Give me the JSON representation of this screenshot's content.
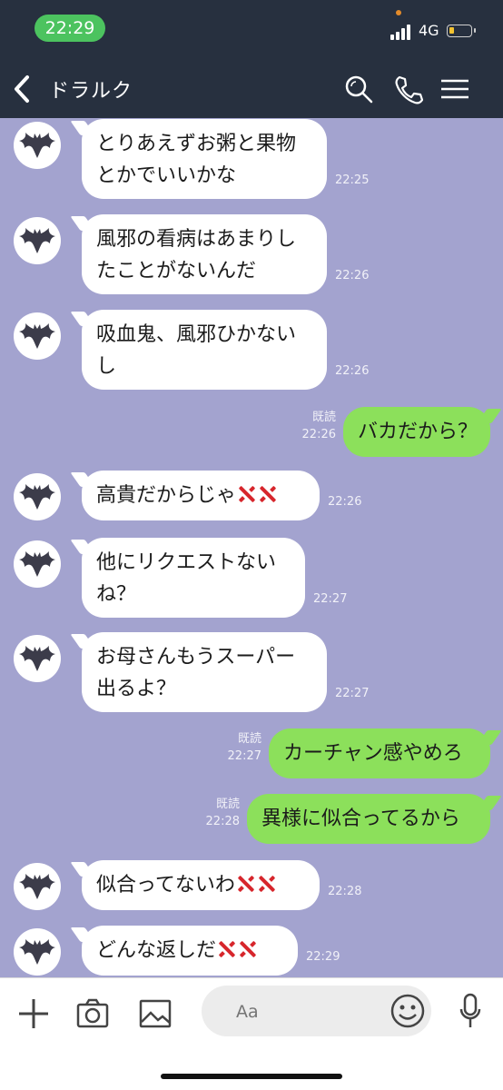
{
  "status": {
    "time": "22:29",
    "network": "4G",
    "battery_level": 0.15
  },
  "header": {
    "title": "ドラルク"
  },
  "icons": {
    "back": "chevron-left-icon",
    "search": "search-icon",
    "call": "phone-icon",
    "menu": "hamburger-menu-icon",
    "avatar": "bat-icon",
    "emoji": "anger-symbol-icon"
  },
  "messages": [
    {
      "side": "in",
      "lines": [
        "とりあえずお粥と果物",
        "とかでいいかな"
      ],
      "time": "22:25"
    },
    {
      "side": "in",
      "lines": [
        "風邪の看病はあまりし",
        "たことがないんだ"
      ],
      "time": "22:26"
    },
    {
      "side": "in",
      "lines": [
        "吸血鬼、風邪ひかない",
        "し"
      ],
      "time": "22:26"
    },
    {
      "side": "out",
      "lines": [
        "バカだから？"
      ],
      "read": "既読",
      "time": "22:26"
    },
    {
      "side": "in",
      "lines": [
        "高貴だからじゃ"
      ],
      "time": "22:26"
    },
    {
      "side": "in",
      "lines": [
        "他にリクエストない",
        "ね？"
      ],
      "time": "22:27"
    },
    {
      "side": "in",
      "lines": [
        "お母さんもうスーパー",
        "出るよ？"
      ],
      "time": "22:27"
    },
    {
      "side": "out",
      "lines": [
        "カーチャン感やめろ"
      ],
      "read": "既読",
      "time": "22:27"
    },
    {
      "side": "out",
      "lines": [
        "異様に似合ってるから"
      ],
      "read": "既読",
      "time": "22:28"
    },
    {
      "side": "in",
      "lines": [
        "似合ってないわ"
      ],
      "time": "22:28"
    },
    {
      "side": "in",
      "lines": [
        "どんな返しだ"
      ],
      "time": "22:29"
    }
  ],
  "composer": {
    "placeholder": "Aa"
  },
  "colors": {
    "chat_bg": "#a3a3cf",
    "header_bg": "#27303f",
    "outgoing": "#8ce05b",
    "incoming": "#ffffff",
    "clock_pill": "#4cc35f"
  }
}
